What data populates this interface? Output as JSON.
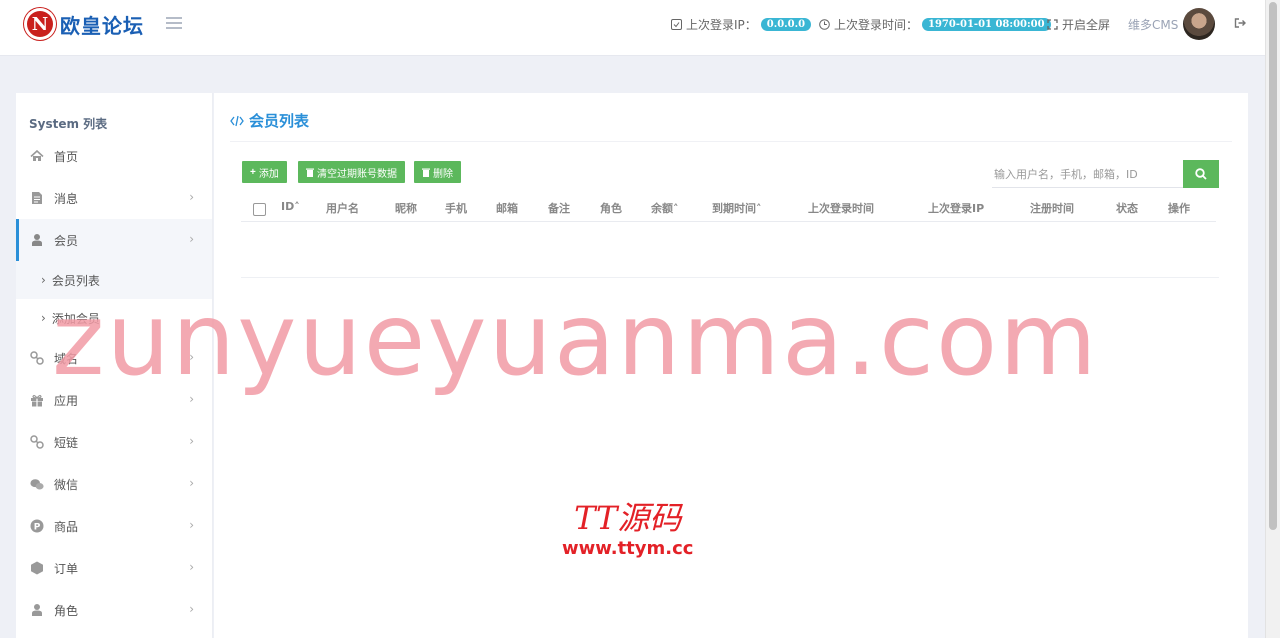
{
  "header": {
    "logo_mark": "N",
    "logo_text": "欧皇论坛",
    "last_ip_label": "上次登录IP：",
    "last_ip_value": "0.0.0.0",
    "last_time_label": "上次登录时间：",
    "last_time_value": "1970-01-01 08:00:00",
    "fullscreen_label": "开启全屏",
    "brand_link": "维多CMS",
    "accent_color": "#3ab6d4"
  },
  "sidebar": {
    "title": "System 列表",
    "items": [
      {
        "label": "首页",
        "icon": "home-icon",
        "chevron": ""
      },
      {
        "label": "消息",
        "icon": "file-icon",
        "chevron": "›"
      },
      {
        "label": "会员",
        "icon": "user-icon",
        "chevron": "›"
      },
      {
        "label": "域名",
        "icon": "link-icon",
        "chevron": "›"
      },
      {
        "label": "应用",
        "icon": "gift-icon",
        "chevron": "›"
      },
      {
        "label": "短链",
        "icon": "link-icon",
        "chevron": "›"
      },
      {
        "label": "微信",
        "icon": "wechat-icon",
        "chevron": "›"
      },
      {
        "label": "商品",
        "icon": "product-icon",
        "chevron": "›"
      },
      {
        "label": "订单",
        "icon": "order-icon",
        "chevron": "›"
      },
      {
        "label": "角色",
        "icon": "role-icon",
        "chevron": "›"
      }
    ],
    "subitems": [
      {
        "label": "会员列表"
      },
      {
        "label": "添加会员"
      }
    ]
  },
  "content": {
    "title": "会员列表",
    "buttons": {
      "add": "添加",
      "clear": "清空过期账号数据",
      "delete": "删除"
    },
    "search_placeholder": "输入用户名，手机，邮箱，ID",
    "columns": [
      "ID",
      "用户名",
      "昵称",
      "手机",
      "邮箱",
      "备注",
      "角色",
      "余额",
      "到期时间",
      "上次登录时间",
      "上次登录IP",
      "注册时间",
      "状态",
      "操作"
    ],
    "sortable": [
      "ID",
      "余额",
      "到期时间"
    ],
    "button_color": "#5cb85c",
    "title_color": "#2a8fd8"
  },
  "watermarks": {
    "domain": "zunyueyuanma.com",
    "brand": "TT源码",
    "brand_url": "www.ttym.cc"
  }
}
